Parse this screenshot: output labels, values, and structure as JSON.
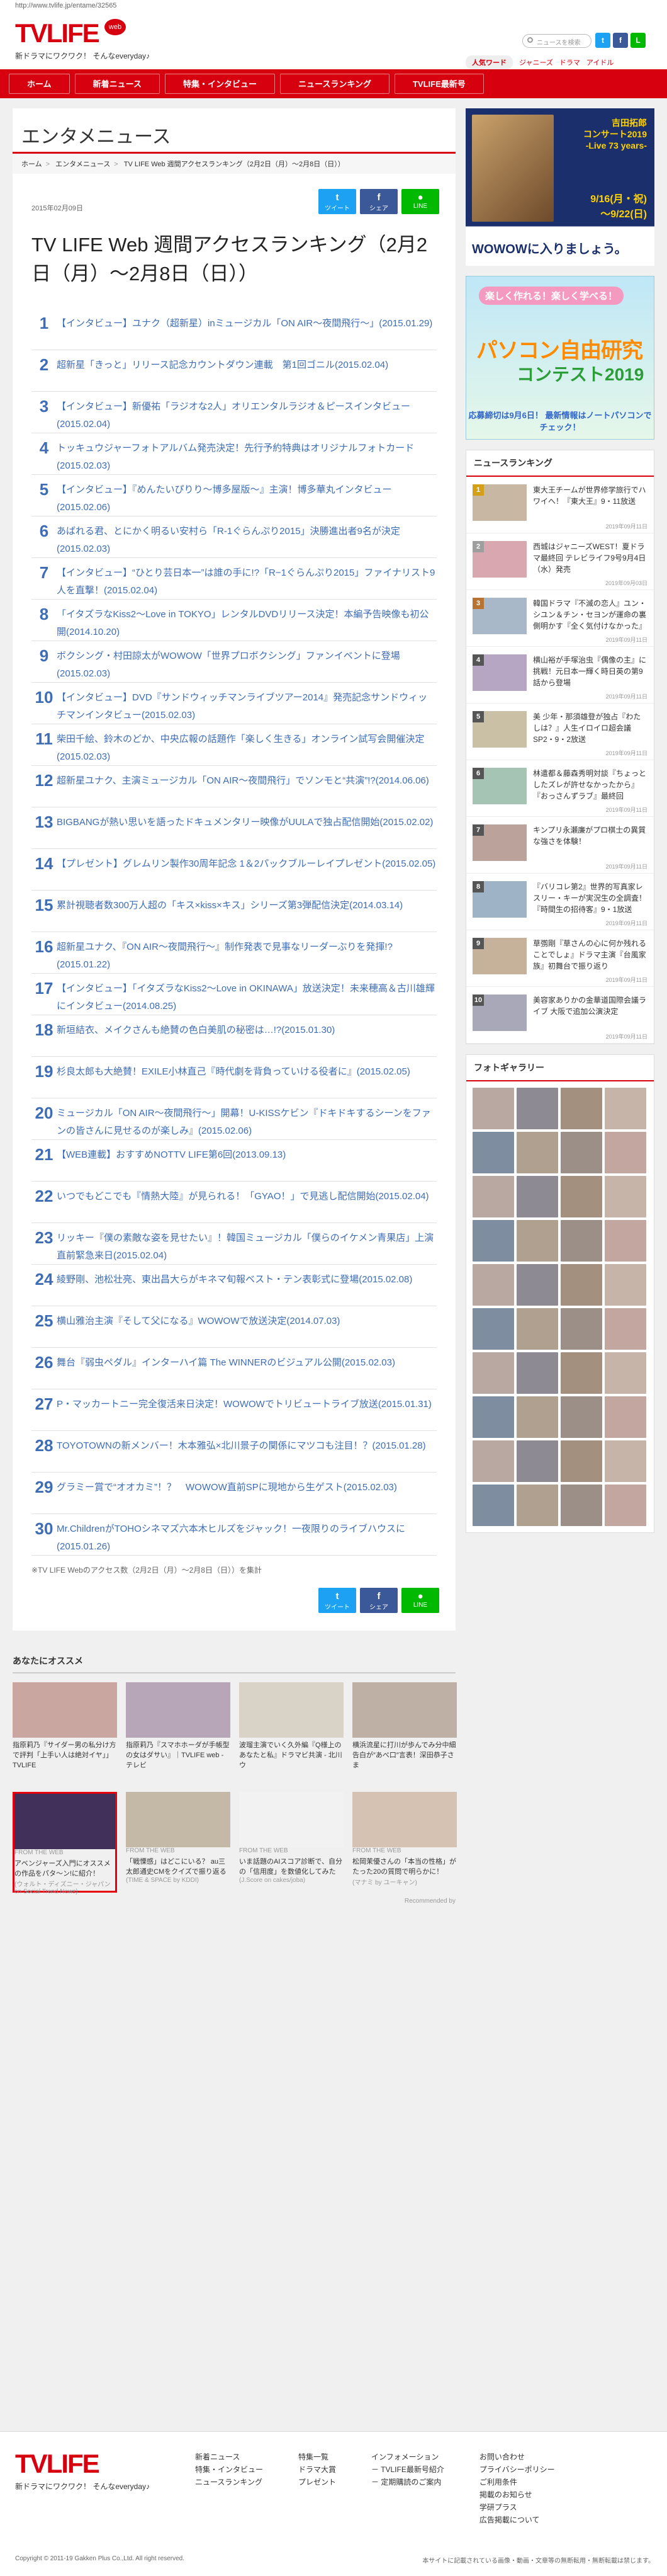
{
  "url_bar": "http://www.tvlife.jp/entame/32565",
  "header": {
    "logo": "TVLIFE",
    "logo_badge": "web",
    "tagline": "新ドラマにワクワク！ そんなeveryday♪",
    "search_placeholder": "ニュースを検索",
    "hotword_label": "人気ワード",
    "hotwords": [
      "ジャニーズ",
      "ドラマ",
      "アイドル"
    ]
  },
  "nav": [
    "ホーム",
    "新着ニュース",
    "特集・インタビュー",
    "ニュースランキング",
    "TVLIFE最新号"
  ],
  "section_title": "エンタメニュース",
  "breadcrumb": [
    "ホーム",
    "エンタメニュース",
    "TV LIFE Web 週間アクセスランキング（2月2日（月）〜2月8日（日））"
  ],
  "article": {
    "date": "2015年02月09日",
    "title": "TV LIFE Web 週間アクセスランキング（2月2日（月）〜2月8日（日））",
    "share": [
      "ツイート",
      "シェア",
      "LINE"
    ],
    "note": "※TV LIFE Webのアクセス数（2月2日（月）〜2月8日（日））を集計",
    "rankings": [
      {
        "rank": "1",
        "text": "【インタビュー】ユナク（超新星）inミュージカル「ON AIR〜夜間飛行〜」(2015.01.29)"
      },
      {
        "rank": "2",
        "text": "超新星「きっと」リリース記念カウントダウン連載　第1回ゴニル(2015.02.04)"
      },
      {
        "rank": "3",
        "text": "【インタビュー】新優祐「ラジオな2人」オリエンタルラジオ＆ピースインタビュー(2015.02.04)"
      },
      {
        "rank": "4",
        "text": "トッキュウジャーフォトアルバム発売決定！先行予約特典はオリジナルフォトカード(2015.02.03)"
      },
      {
        "rank": "5",
        "text": "【インタビュー】『めんたいぴりり〜博多屋版〜』主演！博多華丸インタビュー(2015.02.06)"
      },
      {
        "rank": "6",
        "text": "あばれる君、とにかく明るい安村ら「R-1ぐらんぷり2015」決勝進出者9名が決定(2015.02.03)"
      },
      {
        "rank": "7",
        "text": "【インタビュー】“ひとり芸日本一”は誰の手に!?「R−1ぐらんぷり2015」ファイナリスト9人を直撃！(2015.02.04)"
      },
      {
        "rank": "8",
        "text": "「イタズラなKiss2〜Love in TOKYO」レンタルDVDリリース決定！本編予告映像も初公開(2014.10.20)"
      },
      {
        "rank": "9",
        "text": "ボクシング・村田諒太がWOWOW「世界プロボクシング」ファンイベントに登場(2015.02.03)"
      },
      {
        "rank": "10",
        "text": "【インタビュー】DVD『サンドウィッチマンライブツアー2014』発売記念サンドウィッチマンインタビュー(2015.02.03)"
      },
      {
        "rank": "11",
        "text": "柴田千絵、鈴木のどか、中央広報の話題作「楽しく生きる」オンライン試写会開催決定(2015.02.03)"
      },
      {
        "rank": "12",
        "text": "超新星ユナク、主演ミュージカル「ON AIR〜夜間飛行」でソンモと“共演”!?(2014.06.06)"
      },
      {
        "rank": "13",
        "text": "BIGBANGが熱い思いを語ったドキュメンタリー映像がUULAで独占配信開始(2015.02.02)"
      },
      {
        "rank": "14",
        "text": "【プレゼント】グレムリン製作30周年記念 1＆2パックブルーレイプレゼント(2015.02.05)"
      },
      {
        "rank": "15",
        "text": "累計視聴者数300万人超の「キス×kiss×キス」シリーズ第3弾配信決定(2014.03.14)"
      },
      {
        "rank": "16",
        "text": "超新星ユナク、『ON AIR〜夜間飛行〜』制作発表で見事なリーダーぶりを発揮!?(2015.01.22)"
      },
      {
        "rank": "17",
        "text": "【インタビュー】「イタズラなKiss2〜Love in OKINAWA」放送決定！未来穂高＆古川雄輝にインタビュー(2014.08.25)"
      },
      {
        "rank": "18",
        "text": "新垣結衣、メイクさんも絶賛の色白美肌の秘密は…!?(2015.01.30)"
      },
      {
        "rank": "19",
        "text": "杉良太郎も大絶賛！EXILE小林直己『時代劇を背負っていける役者に』(2015.02.05)"
      },
      {
        "rank": "20",
        "text": "ミュージカル「ON AIR〜夜間飛行〜」開幕！U-KISSケビン『ドキドキするシーンをファンの皆さんに見せるのが楽しみ』(2015.02.06)"
      },
      {
        "rank": "21",
        "text": "【WEB連載】おすすめNOTTV LIFE第6回(2013.09.13)"
      },
      {
        "rank": "22",
        "text": "いつでもどこでも『情熱大陸』が見られる！「GYAO！」で見逃し配信開始(2015.02.04)"
      },
      {
        "rank": "23",
        "text": "リッキー『僕の素敵な姿を見せたい』！韓国ミュージカル「僕らのイケメン青果店」上演直前緊急来日(2015.02.04)"
      },
      {
        "rank": "24",
        "text": "綾野剛、池松壮亮、東出昌大らがキネマ旬報ベスト・テン表彰式に登場(2015.02.08)"
      },
      {
        "rank": "25",
        "text": "横山雅治主演『そして父になる』WOWOWで放送決定(2014.07.03)"
      },
      {
        "rank": "26",
        "text": "舞台『弱虫ペダル』インターハイ篇 The WINNERのビジュアル公開(2015.02.03)"
      },
      {
        "rank": "27",
        "text": "P・マッカートニー完全復活来日決定！WOWOWでトリビュートライブ放送(2015.01.31)"
      },
      {
        "rank": "28",
        "text": "TOYOTOWNの新メンバー！木本雅弘×北川景子の関係にマツコも注目！？(2015.01.28)"
      },
      {
        "rank": "29",
        "text": "グラミー賞で“オオカミ”！？　WOWOW直前SPに現地から生ゲスト(2015.02.03)"
      },
      {
        "rank": "30",
        "text": "Mr.ChildrenがTOHOシネマズ六本木ヒルズをジャック！一夜限りのライブハウスに(2015.01.26)"
      }
    ]
  },
  "sidebar": {
    "banner1": {
      "title": "吉田拓郎\nコンサート2019\n-Live 73 years-",
      "event": "9/16(月・祝)\n〜9/22(日)",
      "footer": "WOWOWに入りましょう。"
    },
    "banner2": {
      "line1": "楽しく作れる！楽しく学べる！",
      "line2": "パソコン自由研究",
      "line3": "コンテスト2019",
      "line4": "応募締切は9月6日！ 最新情報はノートパソコンでチェック！"
    },
    "news_ranking_title": "ニュースランキング",
    "news_ranking": [
      {
        "rank": "1",
        "text": "東大王チームが世界修学旅行でハワイへ！『東大王』9・11放送",
        "date": "2019年09月11日"
      },
      {
        "rank": "2",
        "text": "西城はジャニーズWEST！夏ドラマ最終回 テレビライフ9号9月4日（水）発売",
        "date": "2019年09月03日"
      },
      {
        "rank": "3",
        "text": "韓国ドラマ『不滅の恋人』ユン・シユン＆チン・セヨンが運命の裏側明かす『全く気付けなかった』",
        "date": "2019年09月11日"
      },
      {
        "rank": "4",
        "text": "横山裕が手塚治虫『偶像の主』に挑戦！元日本一輝く時日英の第9話から登場",
        "date": "2019年09月11日"
      },
      {
        "rank": "5",
        "text": "美 少年・那須雄登が独占『わたしは？』人生イロイロ超会議SP2・9・2放送",
        "date": "2019年09月11日"
      },
      {
        "rank": "6",
        "text": "林遣都＆藤森秀明対談『ちょっとしたズレが許せなかったから』『おっさんずラブ』最終回",
        "date": "2019年09月11日"
      },
      {
        "rank": "7",
        "text": "キンプリ永瀬廉がプロ棋士の異質な強さを体験！",
        "date": "2019年09月11日"
      },
      {
        "rank": "8",
        "text": "『バリコレ第2』世界的写真家レスリー・キーが実況生の全調査！『時間生の招待客』9・1放送",
        "date": "2019年09月11日"
      },
      {
        "rank": "9",
        "text": "草彅剛『草さんの心に何か残れることでしょ』ドラマ主演『台風家族』初舞台で振り返り",
        "date": "2019年09月11日"
      },
      {
        "rank": "10",
        "text": "美容家ありかの金華道国際会議ライブ 大阪で追加公演決定",
        "date": "2019年09月11日"
      }
    ],
    "gallery_title": "フォトギャラリー"
  },
  "recommend": {
    "title": "あなたにオススメ",
    "cards": [
      {
        "text": "指原莉乃『サイダー男の私分け方で評判「上手い人は絶対イヤ」」TVLIFE",
        "src": "",
        "tag": ""
      },
      {
        "text": "指原莉乃『スマホホーダが手帳型の女はダサい』｜TVLIFE web - テレビ",
        "src": "",
        "tag": ""
      },
      {
        "text": "波瑠主演でいく久外編『Q様上のあなたと私』ドラマビ共演 - 北川ウ",
        "src": "",
        "tag": ""
      },
      {
        "text": "横浜流星に打川が歩んでみ分中細告白が″あべ口″言表！深田恭子さま",
        "src": "",
        "tag": ""
      },
      {
        "text": "アベンジャーズ入門にオススメの作品をパタ〜ン!に紹介！",
        "src": "(ウォルト・ディズニー・ジャパン on Social Trend News)",
        "tag": "FROM THE WEB"
      },
      {
        "text": "「戦慄感」はどこにいる？ au三太郎通史CMをクイズで振り返る",
        "src": "(TIME & SPACE by KDDI)",
        "tag": "FROM THE WEB"
      },
      {
        "text": "いま話題のAIスコア診断で、自分の「信用度」を数値化してみた",
        "src": "(J.Score on cakes/joba)",
        "tag": "FROM THE WEB"
      },
      {
        "text": "松岡茉優さんの「本当の性格」がたった20の質問で明らかに！",
        "src": "(マナミ by ユーキャン)",
        "tag": "FROM THE WEB"
      }
    ],
    "by": "Recommended by"
  },
  "footer": {
    "col1": [
      "新着ニュース",
      "特集・インタビュー",
      "ニュースランキング"
    ],
    "col2": [
      "特集一覧",
      "ドラマ大賞",
      "プレゼント"
    ],
    "col3": [
      "インフォメーション",
      "－ TVLIFE最新号紹介",
      "－ 定期購読のご案内"
    ],
    "col4": [
      "お問い合わせ",
      "プライバシーポリシー",
      "ご利用条件",
      "掲載のお知らせ",
      "学研プラス",
      "広告掲載について"
    ],
    "copyright": "Copyright © 2011-19 Gakken Plus Co.,Ltd. All right reserved.",
    "note": "本サイトに記載されている画像・動画・文章等の無断転用・無断転載は禁じます。"
  },
  "colors": {
    "brand_red": "#d7000f",
    "link_blue": "#3e6db5",
    "twitter": "#1da1f2",
    "facebook": "#3b5998",
    "line": "#00b900"
  }
}
